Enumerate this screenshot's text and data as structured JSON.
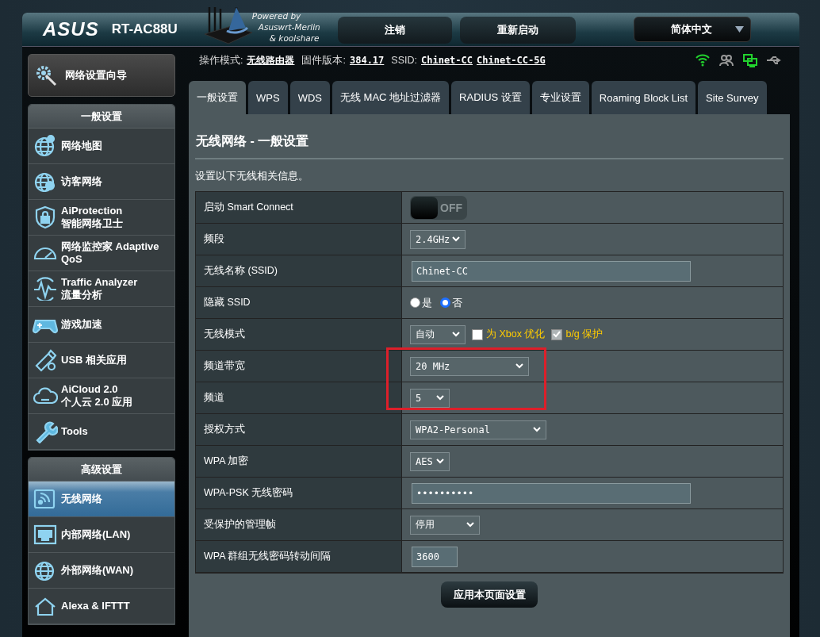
{
  "header": {
    "brand": "ASUS",
    "model": "RT-AC88U",
    "powered_by": [
      "Powered by",
      "Asuswrt-Merlin",
      "& koolshare"
    ],
    "buttons": [
      "注销",
      "重新启动"
    ],
    "language": "简体中文"
  },
  "status_line": [
    {
      "label": "操作模式:",
      "links": [
        "无线路由器"
      ]
    },
    {
      "label": "固件版本:",
      "links": [
        "384.17"
      ]
    },
    {
      "label": "SSID:",
      "links": [
        "Chinet-CC",
        "Chinet-CC-5G"
      ]
    }
  ],
  "status_icons": [
    {
      "active": true
    },
    {
      "active": false
    },
    {
      "active": true
    },
    {
      "active": false
    }
  ],
  "sidebar": {
    "wizard": "网络设置向导",
    "sections": [
      {
        "title": "一般设置",
        "items": [
          {
            "lines": [
              "网络地图"
            ],
            "selected": false
          },
          {
            "lines": [
              "访客网络"
            ],
            "selected": false
          },
          {
            "lines": [
              "AiProtection",
              "智能网络卫士"
            ],
            "selected": false
          },
          {
            "lines": [
              "网络监控家 Adaptive",
              "QoS"
            ],
            "selected": false
          },
          {
            "lines": [
              "Traffic Analyzer",
              "流量分析"
            ],
            "selected": false
          },
          {
            "lines": [
              "游戏加速"
            ],
            "selected": false
          },
          {
            "lines": [
              "USB 相关应用"
            ],
            "selected": false
          },
          {
            "lines": [
              "AiCloud 2.0",
              "个人云 2.0 应用"
            ],
            "selected": false
          },
          {
            "lines": [
              "Tools"
            ],
            "selected": false
          }
        ]
      },
      {
        "title": "高级设置",
        "items": [
          {
            "lines": [
              "无线网络"
            ],
            "selected": true
          },
          {
            "lines": [
              "内部网络(LAN)"
            ],
            "selected": false
          },
          {
            "lines": [
              "外部网络(WAN)"
            ],
            "selected": false
          },
          {
            "lines": [
              "Alexa & IFTTT"
            ],
            "selected": false
          }
        ]
      }
    ]
  },
  "tabs": [
    {
      "label": "一般设置",
      "selected": true
    },
    {
      "label": "WPS",
      "selected": false
    },
    {
      "label": "WDS",
      "selected": false
    },
    {
      "label": "无线 MAC 地址过滤器",
      "selected": false
    },
    {
      "label": "RADIUS 设置",
      "selected": false
    },
    {
      "label": "专业设置",
      "selected": false
    },
    {
      "label": "Roaming Block List",
      "selected": false
    },
    {
      "label": "Site Survey",
      "selected": false
    }
  ],
  "panel": {
    "title": "无线网络 - 一般设置",
    "description": "设置以下无线相关信息。",
    "rows": [
      {
        "label": "启动 Smart Connect",
        "kind": "toggle",
        "on": false,
        "off_text": "OFF"
      },
      {
        "label": "频段",
        "kind": "select",
        "value": "2.4GHz"
      },
      {
        "label": "无线名称 (SSID)",
        "kind": "input",
        "value": "Chinet-CC"
      },
      {
        "label": "隐藏 SSID",
        "kind": "radio",
        "options": [
          {
            "label": "是",
            "selected": false
          },
          {
            "label": "否",
            "selected": true
          }
        ]
      },
      {
        "label": "无线模式",
        "kind": "select_checks",
        "value": "自动",
        "checks": [
          {
            "label": "为 Xbox 优化",
            "checked": false,
            "disabled": false
          },
          {
            "label": "b/g 保护",
            "checked": true,
            "disabled": true
          }
        ]
      },
      {
        "label": "频道带宽",
        "kind": "select",
        "value": "20 MHz"
      },
      {
        "label": "频道",
        "kind": "select",
        "value": "5"
      },
      {
        "label": "授权方式",
        "kind": "select",
        "value": "WPA2-Personal"
      },
      {
        "label": "WPA 加密",
        "kind": "select",
        "value": "AES"
      },
      {
        "label": "WPA-PSK 无线密码",
        "kind": "input",
        "value": "••••••••••"
      },
      {
        "label": "受保护的管理帧",
        "kind": "select",
        "value": "停用"
      },
      {
        "label": "WPA 群组无线密码转动间隔",
        "kind": "input",
        "value": "3600"
      }
    ],
    "apply_button": "应用本页面设置"
  }
}
